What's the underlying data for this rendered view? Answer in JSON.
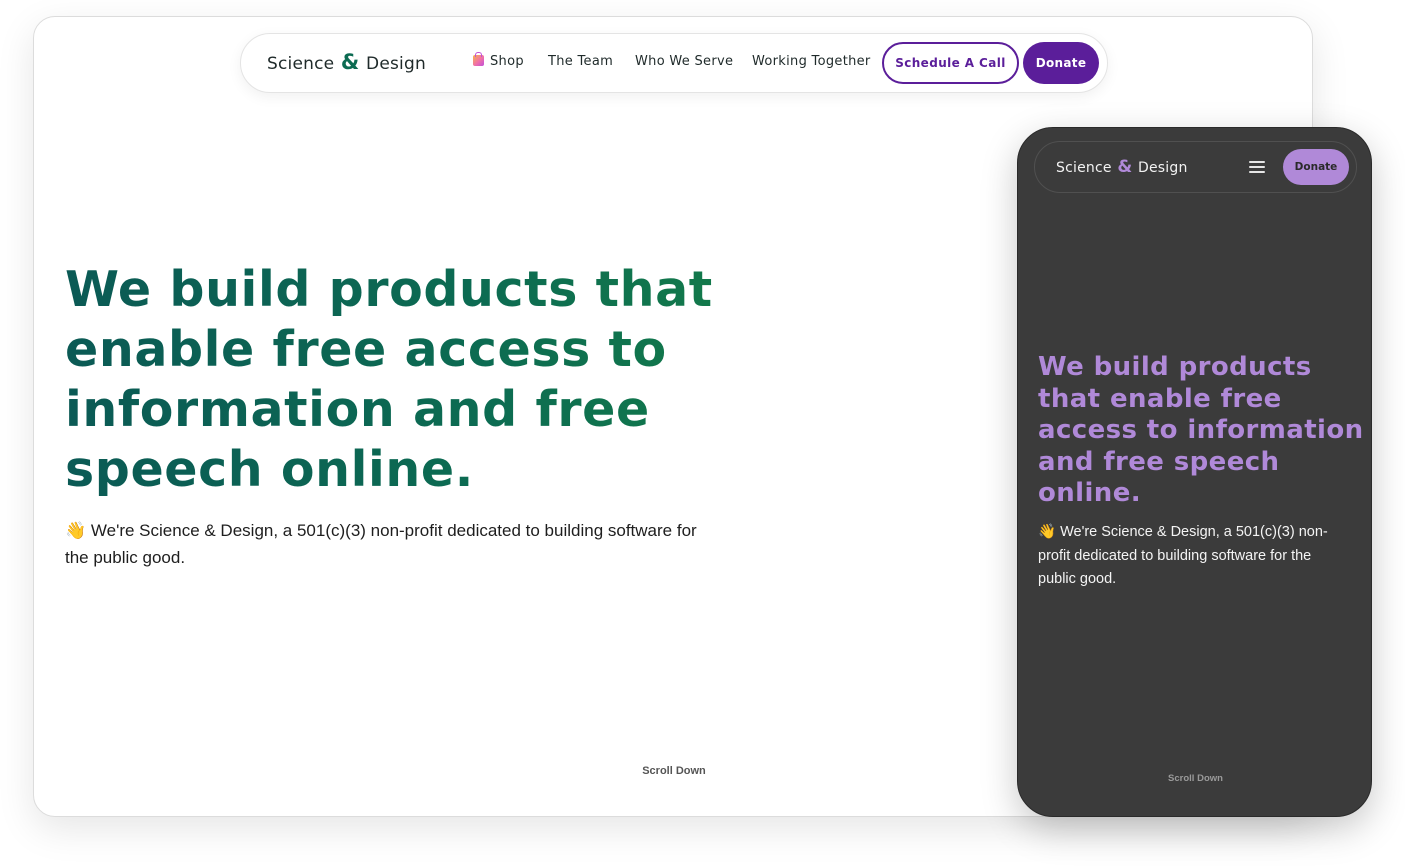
{
  "desktop": {
    "nav": {
      "brand": {
        "part1": "Science",
        "amp": "&",
        "part2": "Design"
      },
      "links": [
        "Shop",
        "The Team",
        "Who We Serve",
        "Working Together"
      ],
      "shop_icon": "shopping-bag-icon",
      "schedule_label": "Schedule A Call",
      "donate_label": "Donate"
    },
    "hero": {
      "title": "We build products that enable free access to information and free speech online.",
      "subtitle": "👋 We're Science & Design, a 501(c)(3) non-profit dedicated to building software for the public good."
    },
    "scroll_label": "Scroll Down"
  },
  "mobile": {
    "nav": {
      "brand": {
        "part1": "Science",
        "amp": "&",
        "part2": "Design"
      },
      "menu_icon": "hamburger-menu-icon",
      "donate_label": "Donate"
    },
    "hero": {
      "title": "We build products that enable free access to information and free speech online.",
      "subtitle": "👋 We're Science & Design, a 501(c)(3) non-profit dedicated to building software for the public good."
    },
    "scroll_label": "Scroll Down"
  },
  "colors": {
    "brand_green": "#0c6b52",
    "brand_purple": "#5b1e9a",
    "mobile_accent": "#b089d8",
    "mobile_background": "#3b3b3b"
  }
}
